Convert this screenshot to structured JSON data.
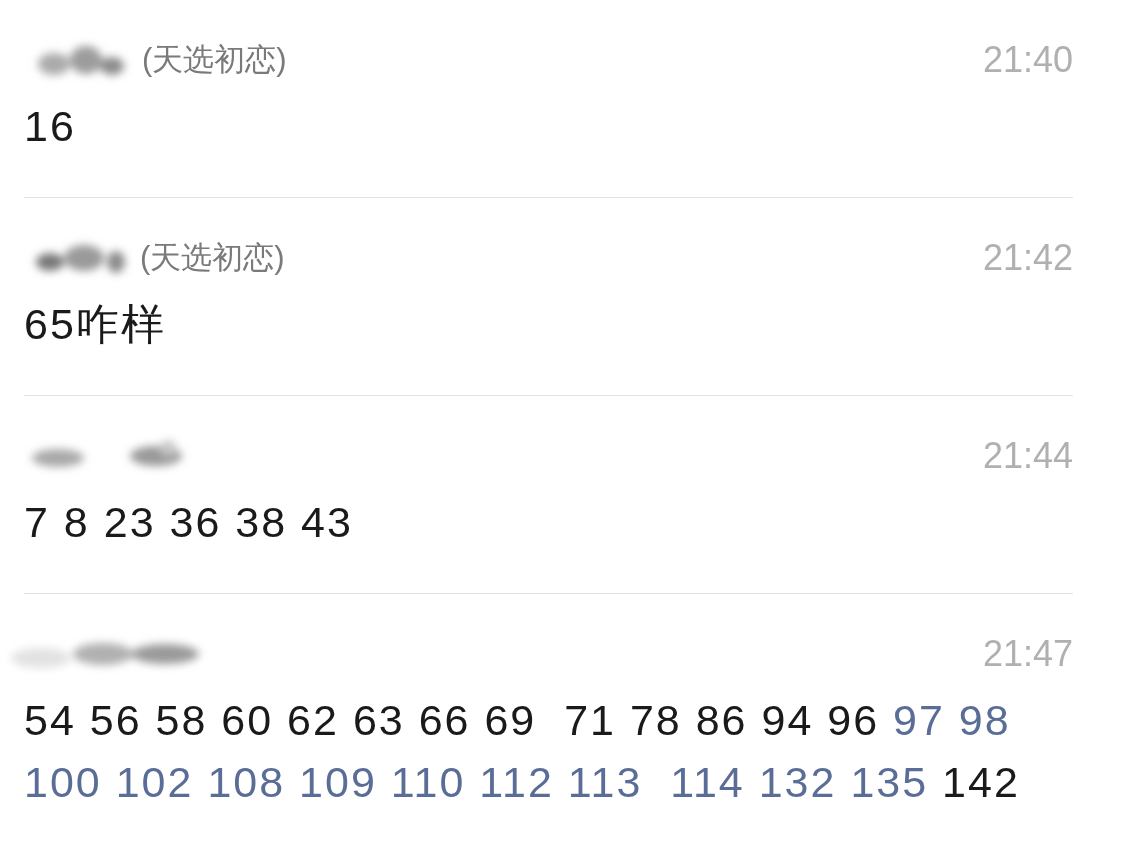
{
  "comments": [
    {
      "tag": "(天选初恋)",
      "time": "21:40",
      "message": [
        {
          "kind": "plain",
          "text": "16"
        }
      ]
    },
    {
      "tag": "(天选初恋)",
      "time": "21:42",
      "message": [
        {
          "kind": "plain",
          "text": "65咋样"
        }
      ]
    },
    {
      "time": "21:44",
      "message": [
        {
          "kind": "plain",
          "text": "7 8 23 36 38 43"
        }
      ]
    },
    {
      "time": "21:47",
      "message": [
        {
          "kind": "plain",
          "text": "54 56 58 60 62 63 66 69  71 78 86 94 96 "
        },
        {
          "kind": "highlight",
          "text": "97 98 100 102 108 109 110 112 113  114 132 135"
        },
        {
          "kind": "plain",
          "text": " 142"
        }
      ]
    }
  ]
}
